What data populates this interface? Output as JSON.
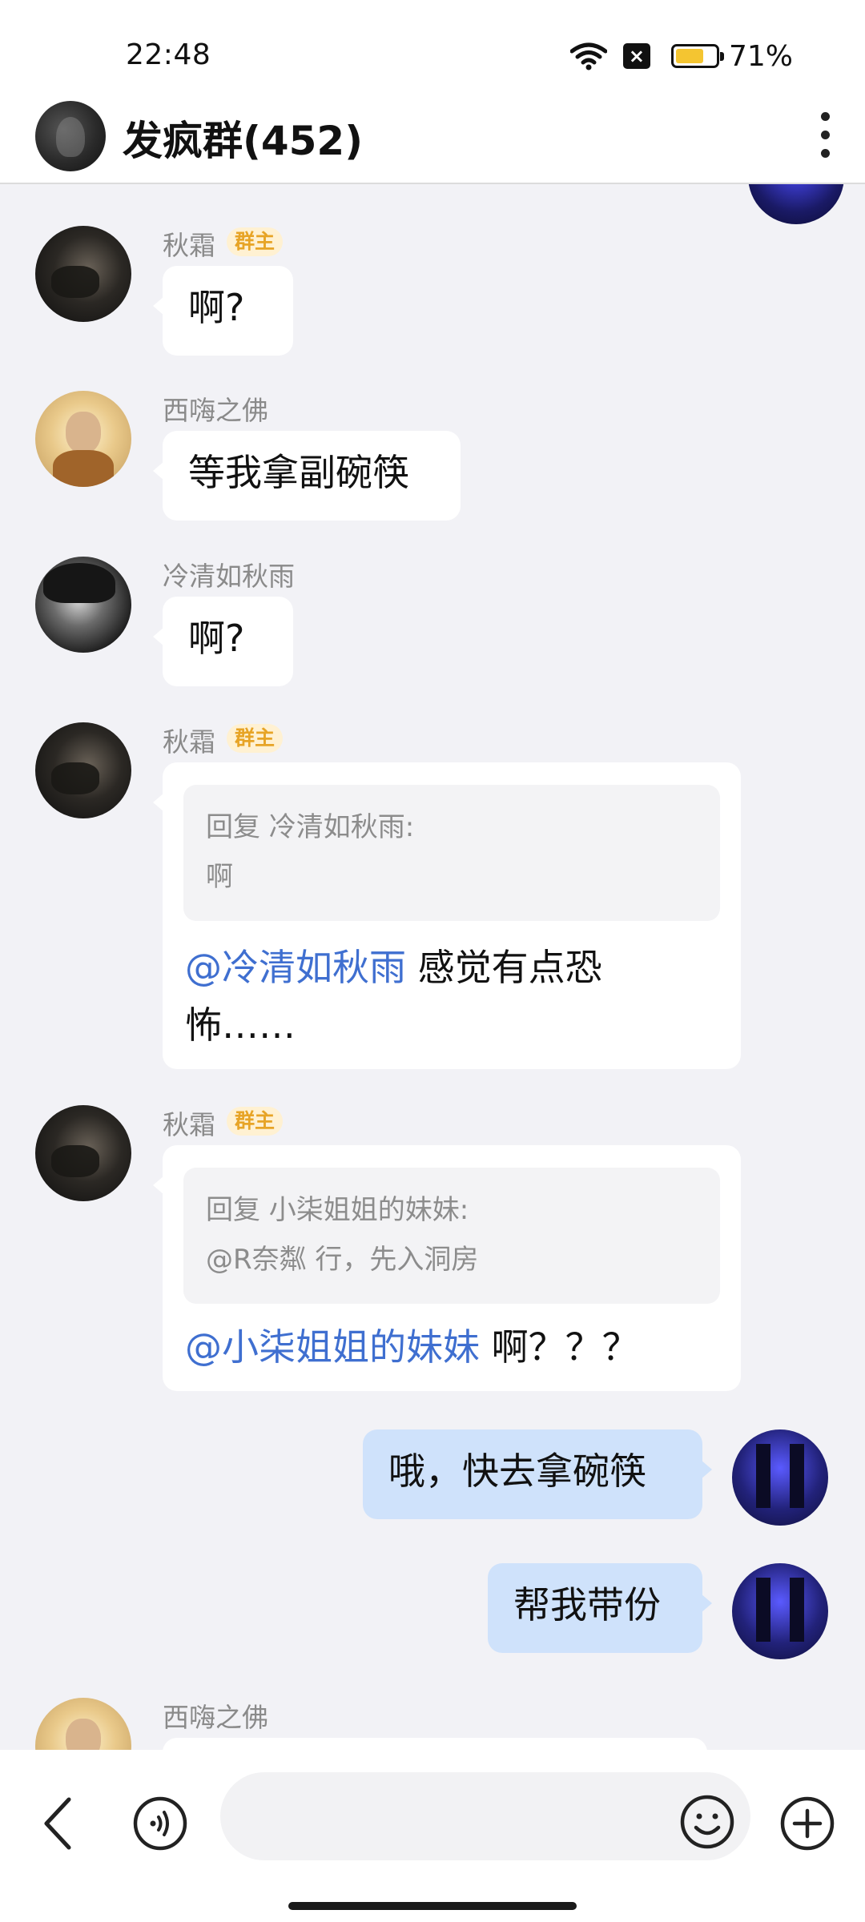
{
  "status_bar": {
    "time": "22:48",
    "battery_percent": 71,
    "battery_label": "71%",
    "icons": [
      "wifi-icon",
      "x-icon",
      "battery-icon"
    ]
  },
  "header": {
    "title": "发疯群(452)",
    "icons": [
      "group-avatar",
      "more-icon"
    ]
  },
  "badges": {
    "owner": "群主"
  },
  "messages": [
    {
      "sender": "秋霜",
      "is_owner": true,
      "text": "啊?"
    },
    {
      "sender": "西嗨之佛",
      "is_owner": false,
      "text": "等我拿副碗筷"
    },
    {
      "sender": "冷清如秋雨",
      "is_owner": false,
      "text": "啊?"
    },
    {
      "sender": "秋霜",
      "is_owner": true,
      "quote_header": "回复 冷清如秋雨:",
      "quote_text": "啊",
      "mention": "@冷清如秋雨",
      "text_line1": " 感觉有点恐",
      "text_line2": "怖……"
    },
    {
      "sender": "秋霜",
      "is_owner": true,
      "quote_header": "回复 小柒姐姐的妹妹:",
      "quote_text": "@R奈粼 行，先入洞房",
      "mention": "@小柒姐姐的妹妹",
      "text": " 啊？？？"
    },
    {
      "sender": "self",
      "text": "哦，快去拿碗筷"
    },
    {
      "sender": "self",
      "text": "帮我带份"
    },
    {
      "sender": "西嗨之佛",
      "is_owner": false,
      "text": ""
    }
  ],
  "bottom_bar": {
    "input_placeholder": "",
    "icons": [
      "back-icon",
      "voice-icon",
      "emoji-icon",
      "plus-icon"
    ]
  }
}
